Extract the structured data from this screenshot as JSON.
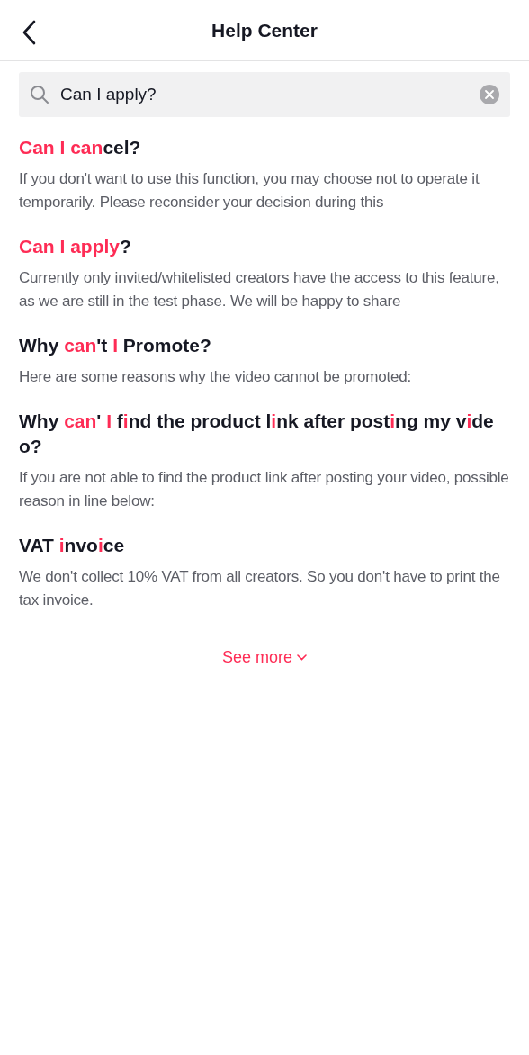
{
  "header": {
    "title": "Help Center"
  },
  "search": {
    "value": "Can I apply?"
  },
  "results": [
    {
      "title": [
        {
          "text": "Can I can",
          "highlight": true
        },
        {
          "text": "cel?",
          "highlight": false
        }
      ],
      "snippet": "If you don't want to use this function, you may choose not to operate it temporarily. Please reconsider your decision during this"
    },
    {
      "title": [
        {
          "text": "Can I apply",
          "highlight": true
        },
        {
          "text": "?",
          "highlight": false
        }
      ],
      "snippet": "Currently only invited/whitelisted creators have the access to this feature, as we are still in the test phase. We will be happy to share"
    },
    {
      "title": [
        {
          "text": "Why ",
          "highlight": false
        },
        {
          "text": "can",
          "highlight": true
        },
        {
          "text": "'t ",
          "highlight": false
        },
        {
          "text": "I",
          "highlight": true
        },
        {
          "text": " Promote?",
          "highlight": false
        }
      ],
      "snippet": "Here are some reasons why the video cannot be promoted:"
    },
    {
      "title": [
        {
          "text": "Why ",
          "highlight": false
        },
        {
          "text": "can",
          "highlight": true
        },
        {
          "text": "' ",
          "highlight": false
        },
        {
          "text": "I",
          "highlight": true
        },
        {
          "text": " f",
          "highlight": false
        },
        {
          "text": "i",
          "highlight": true
        },
        {
          "text": "nd the product l",
          "highlight": false
        },
        {
          "text": "i",
          "highlight": true
        },
        {
          "text": "nk after post",
          "highlight": false
        },
        {
          "text": "i",
          "highlight": true
        },
        {
          "text": "ng my v",
          "highlight": false
        },
        {
          "text": "i",
          "highlight": true
        },
        {
          "text": "deo?",
          "highlight": false
        }
      ],
      "snippet": "If you are not able to find the product link after posting your video, possible reason in line below:"
    },
    {
      "title": [
        {
          "text": "VAT ",
          "highlight": false
        },
        {
          "text": "i",
          "highlight": true
        },
        {
          "text": "nvo",
          "highlight": false
        },
        {
          "text": "i",
          "highlight": true
        },
        {
          "text": "ce",
          "highlight": false
        }
      ],
      "snippet": "We don't collect 10% VAT from all creators. So you don't have to print the tax invoice."
    }
  ],
  "see_more": "See more"
}
